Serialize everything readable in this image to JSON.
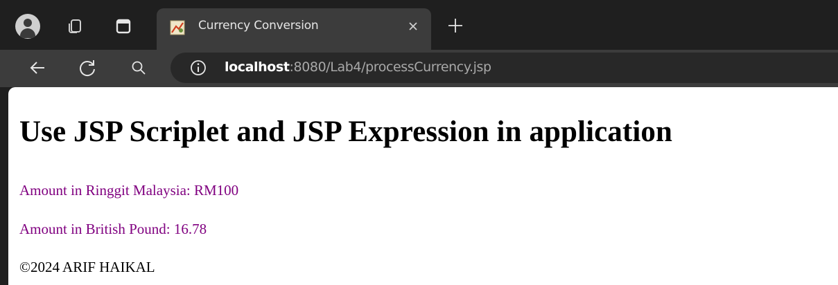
{
  "browser": {
    "tab": {
      "title": "Currency Conversion",
      "close_glyph": "×"
    },
    "new_tab_glyph": "+",
    "address_bar": {
      "host": "localhost",
      "rest": ":8080/Lab4/processCurrency.jsp"
    },
    "icons": {
      "profile": "profile-avatar-icon",
      "tab_groups": "tab-groups-icon",
      "tab_strip": "vertical-tabs-icon",
      "back": "back-arrow-icon",
      "reload": "reload-icon",
      "search": "search-icon",
      "site_info": "site-info-icon",
      "favicon": "jsp-favicon-icon"
    },
    "colors": {
      "frame": "#1f1f1f",
      "toolbar": "#3c3c3c",
      "omnibox": "#282828"
    }
  },
  "page": {
    "heading": "Use JSP Scriplet and JSP Expression in application",
    "lines": {
      "ringgit": "Amount in Ringgit Malaysia: RM100",
      "pound": "Amount in British Pound: 16.78",
      "footer": "©2024 ARIF HAIKAL"
    },
    "colors": {
      "text_purple": "#800080",
      "text_black": "#000000"
    }
  }
}
